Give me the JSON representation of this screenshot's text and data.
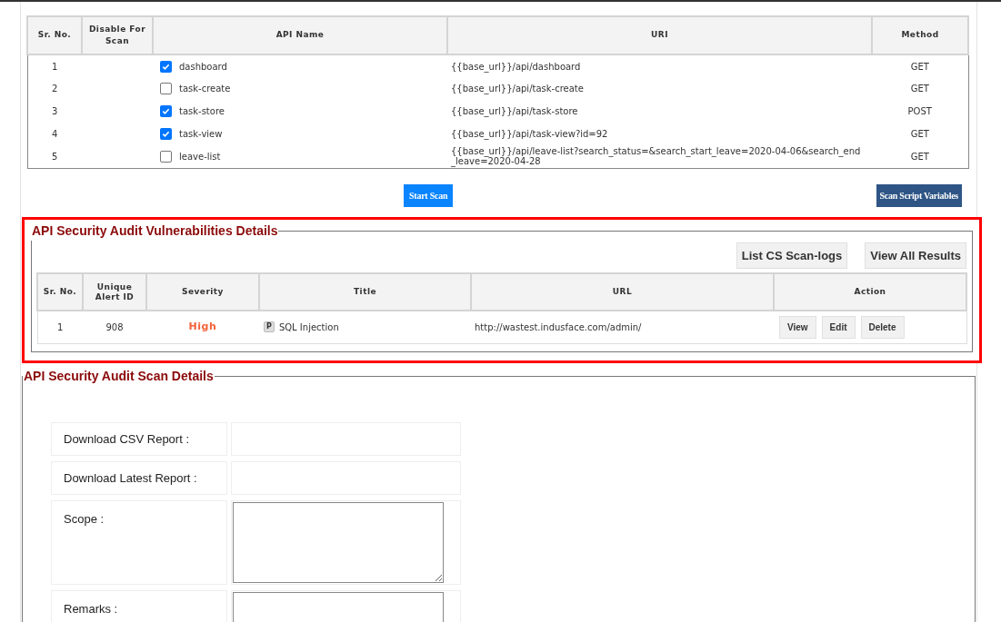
{
  "api_table": {
    "columns": [
      "Sr. No.",
      "Disable For Scan",
      "API Name",
      "URI",
      "Method"
    ],
    "rows": [
      {
        "sr": "1",
        "checked": true,
        "name": "dashboard",
        "uri": "{{base_url}}/api/dashboard",
        "method": "GET"
      },
      {
        "sr": "2",
        "checked": false,
        "name": "task-create",
        "uri": "{{base_url}}/api/task-create",
        "method": "GET"
      },
      {
        "sr": "3",
        "checked": true,
        "name": "task-store",
        "uri": "{{base_url}}/api/task-store",
        "method": "POST"
      },
      {
        "sr": "4",
        "checked": true,
        "name": "task-view",
        "uri": "{{base_url}}/api/task-view?id=92",
        "method": "GET"
      },
      {
        "sr": "5",
        "checked": false,
        "name": "leave-list",
        "uri": "{{base_url}}/api/leave-list?search_status=&search_start_leave=2020-04-06&search_end_leave=2020-04-28",
        "method": "GET"
      }
    ]
  },
  "scan_buttons": [
    "Start Scan",
    "Scan Script Variables"
  ],
  "vulnerabilities": {
    "title": "API Security Audit Vulnerabilities Details",
    "buttons": [
      "List CS Scan-logs",
      "View All Results"
    ],
    "columns": [
      "Sr. No.",
      "Unique Alert ID",
      "Severity",
      "Title",
      "URL",
      "Action"
    ],
    "rows": [
      {
        "sr": "1",
        "alert_id": "908",
        "severity": "High",
        "badge": "P",
        "title": "SQL Injection",
        "url": "http://wastest.indusface.com/admin/",
        "actions": [
          "View",
          "Edit",
          "Delete"
        ]
      }
    ]
  },
  "scan_details": {
    "title": "API Security Audit Scan Details",
    "fields": [
      {
        "kind": "link",
        "label": "Download CSV Report :"
      },
      {
        "kind": "link",
        "label": "Download Latest Report :"
      },
      {
        "kind": "textarea",
        "label": "Scope :"
      },
      {
        "kind": "textarea",
        "label": "Remarks :"
      }
    ]
  }
}
